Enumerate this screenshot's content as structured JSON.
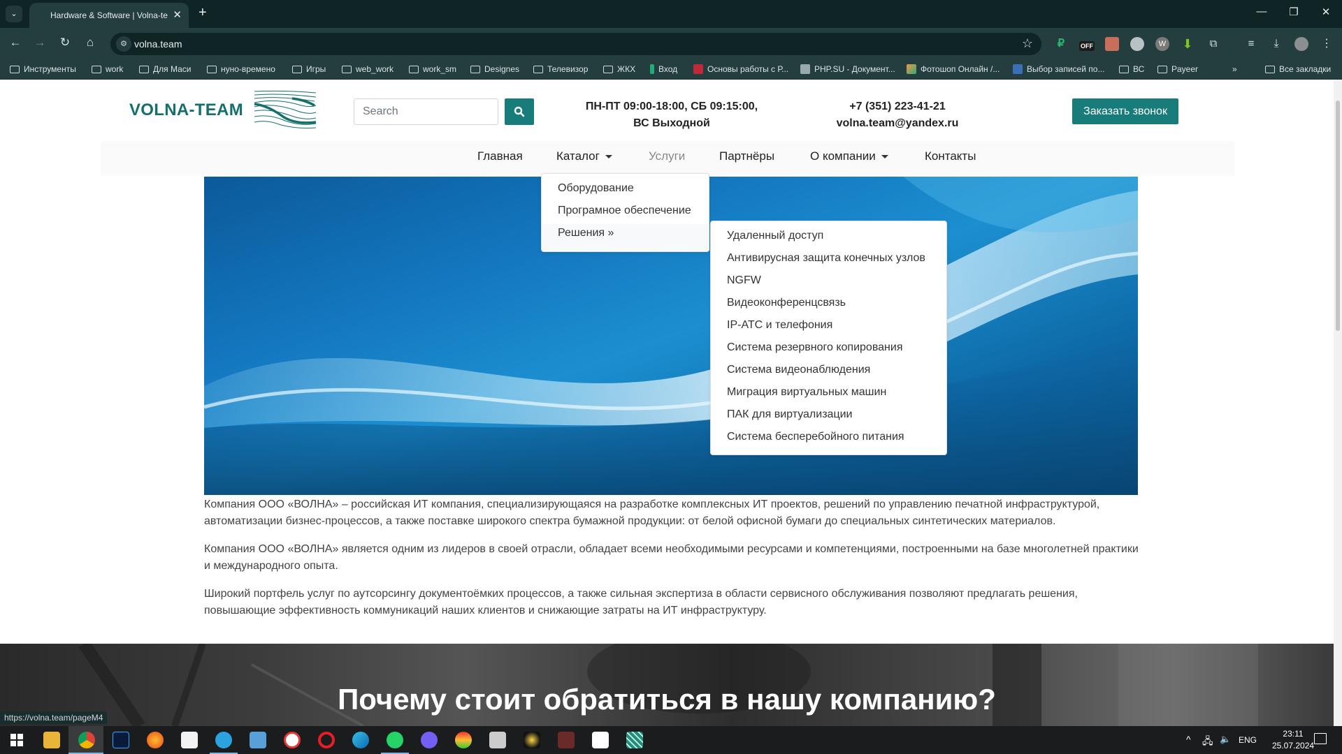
{
  "browser": {
    "tab_title": "Hardware & Software | Volna-team",
    "url": "volna.team",
    "status_url": "https://volna.team/pageM4",
    "bookmarks": [
      {
        "label": "Инструменты",
        "type": "folder"
      },
      {
        "label": "work",
        "type": "folder"
      },
      {
        "label": "Для Маси",
        "type": "folder"
      },
      {
        "label": "нуно-времено",
        "type": "folder"
      },
      {
        "label": "Игры",
        "type": "folder"
      },
      {
        "label": "web_work",
        "type": "folder"
      },
      {
        "label": "work_sm",
        "type": "folder"
      },
      {
        "label": "Designes",
        "type": "folder"
      },
      {
        "label": "Телевизор",
        "type": "folder"
      },
      {
        "label": "ЖКХ",
        "type": "folder"
      },
      {
        "label": "Вход",
        "type": "link"
      },
      {
        "label": "Основы работы с Р...",
        "type": "link"
      },
      {
        "label": "PHP.SU - Документ...",
        "type": "link"
      },
      {
        "label": "Фотошоп Онлайн /...",
        "type": "link"
      },
      {
        "label": "Выбор записей по...",
        "type": "link"
      },
      {
        "label": "ВС",
        "type": "folder"
      },
      {
        "label": "Payeer",
        "type": "folder"
      }
    ],
    "more_bookmarks": "»",
    "all_bookmarks": "Все закладки",
    "extension_badge": "OFF"
  },
  "header": {
    "logo_text": "VOLNA-TEAM",
    "search_placeholder": "Search",
    "hours_line1": "ПН-ПТ 09:00-18:00, СБ 09:15:00,",
    "hours_line2": "ВС Выходной",
    "phone": "+7 (351) 223-41-21",
    "email": "volna.team@yandex.ru",
    "callback_button": "Заказать звонок"
  },
  "nav": {
    "items": [
      {
        "label": "Главная"
      },
      {
        "label": "Каталог"
      },
      {
        "label": "Услуги"
      },
      {
        "label": "Партнёры"
      },
      {
        "label": "О компании"
      },
      {
        "label": "Контакты"
      }
    ]
  },
  "catalog_menu": {
    "items": [
      {
        "label": "Оборудование"
      },
      {
        "label": "Програмное обеспечение"
      },
      {
        "label": "Решения »"
      }
    ]
  },
  "solutions_menu": {
    "items": [
      {
        "label": "Удаленный доступ"
      },
      {
        "label": "Антивирусная защита конечных узлов"
      },
      {
        "label": "NGFW"
      },
      {
        "label": "Видеоконференцсвязь"
      },
      {
        "label": "IP-АТС и телефония"
      },
      {
        "label": "Система резервного копирования"
      },
      {
        "label": "Система видеонаблюдения"
      },
      {
        "label": "Миграция виртуальных машин"
      },
      {
        "label": "ПАК для виртуализации"
      },
      {
        "label": "Система бесперебойного питания"
      }
    ]
  },
  "content": {
    "paragraphs": [
      "Компания ООО «ВОЛНА» – российская ИТ компания, специализирующаяся на разработке комплексных ИТ проектов, решений по управлению печатной инфраструктурой, автоматизации бизнес-процессов, а также поставке широкого спектра бумажной продукции: от белой офисной бумаги до специальных синтетических материалов.",
      "Компания ООО «ВОЛНА» является одним из лидеров в своей отрасли, обладает всеми необходимыми ресурсами и компетенциями, построенными на базе многолетней практики и международного опыта.",
      "Широкий портфель услуг по аутсорсингу документоёмких процессов, а также сильная экспертиза в области сервисного обслуживания позволяют предлагать решения, повышающие эффективность коммуникаций наших клиентов и снижающие затраты на ИТ инфраструктуру."
    ],
    "why_title": "Почему стоит обратиться в нашу компанию?"
  },
  "taskbar": {
    "language": "ENG",
    "time": "23:11",
    "date": "25.07.2024"
  },
  "colors": {
    "brand": "#187d7a",
    "chrome_dark": "#0e2425",
    "chrome_mid": "#243d3e"
  }
}
